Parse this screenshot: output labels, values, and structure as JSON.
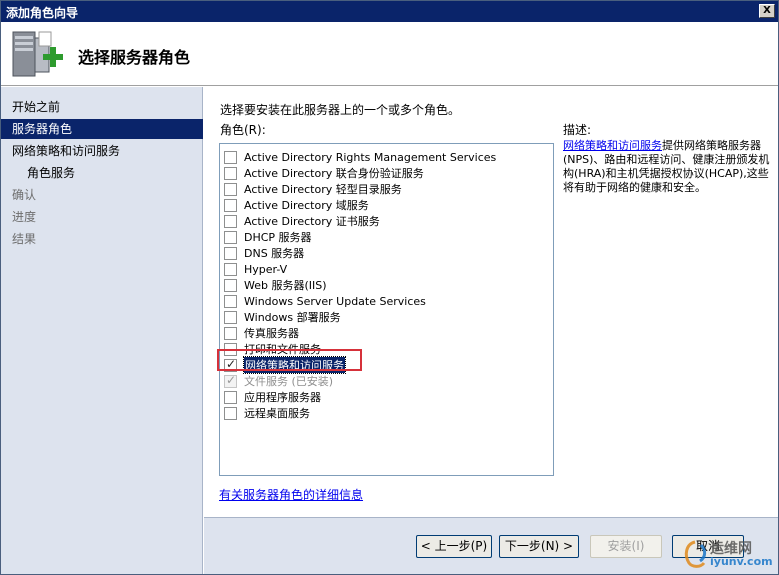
{
  "window": {
    "title": "添加角色向导",
    "close_label": "X"
  },
  "header": {
    "title": "选择服务器角色",
    "icon": "server-add-icon"
  },
  "sidebar": {
    "items": [
      {
        "label": "开始之前",
        "state": "normal"
      },
      {
        "label": "服务器角色",
        "state": "active"
      },
      {
        "label": "网络策略和访问服务",
        "state": "normal"
      },
      {
        "label": "角色服务",
        "state": "sub"
      },
      {
        "label": "确认",
        "state": "disabled"
      },
      {
        "label": "进度",
        "state": "disabled"
      },
      {
        "label": "结果",
        "state": "disabled"
      }
    ]
  },
  "main": {
    "instruction": "选择要安装在此服务器上的一个或多个角色。",
    "roles_label": "角色(R):",
    "roles": [
      {
        "label": "Active Directory Rights Management Services",
        "checked": false
      },
      {
        "label": "Active Directory 联合身份验证服务",
        "checked": false
      },
      {
        "label": "Active Directory 轻型目录服务",
        "checked": false
      },
      {
        "label": "Active Directory 域服务",
        "checked": false
      },
      {
        "label": "Active Directory 证书服务",
        "checked": false
      },
      {
        "label": "DHCP 服务器",
        "checked": false
      },
      {
        "label": "DNS 服务器",
        "checked": false
      },
      {
        "label": "Hyper-V",
        "checked": false
      },
      {
        "label": "Web 服务器(IIS)",
        "checked": false
      },
      {
        "label": "Windows Server Update Services",
        "checked": false
      },
      {
        "label": "Windows 部署服务",
        "checked": false
      },
      {
        "label": "传真服务器",
        "checked": false
      },
      {
        "label": "打印和文件服务",
        "checked": false
      },
      {
        "label": "网络策略和访问服务",
        "checked": true,
        "selected": true
      },
      {
        "label": "文件服务  (已安装)",
        "checked": true,
        "disabled": true
      },
      {
        "label": "应用程序服务器",
        "checked": false
      },
      {
        "label": "远程桌面服务",
        "checked": false
      }
    ],
    "description_label": "描述:",
    "description_link": "网络策略和访问服务",
    "description_text": "提供网络策略服务器(NPS)、路由和远程访问、健康注册颁发机构(HRA)和主机凭据授权协议(HCAP),这些将有助于网络的健康和安全。",
    "more_info_link": "有关服务器角色的详细信息"
  },
  "footer": {
    "prev_label": "< 上一步(P)",
    "next_label": "下一步(N) >",
    "install_label": "安装(I)",
    "cancel_label": "取消"
  },
  "watermark": {
    "line1": "运维网",
    "line2": "iyunv.com"
  },
  "colors": {
    "accent": "#0a246a",
    "sidebar_bg": "#dde3ee",
    "highlight": "#d6313a",
    "link": "#0000ee"
  }
}
